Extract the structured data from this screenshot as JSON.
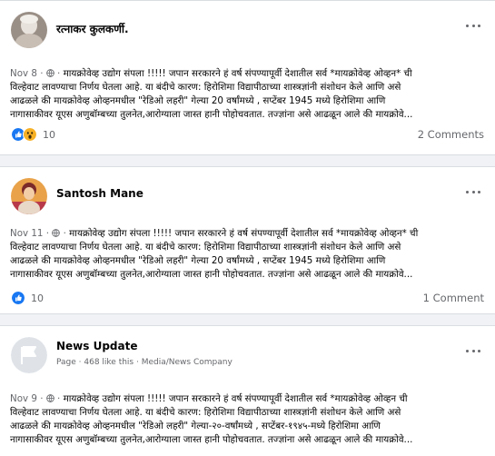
{
  "posts": [
    {
      "author": "रत्नाकर कुलकर्णी.",
      "date": "Nov 8",
      "lines": [
        " मायक्रोवेव्ह उद्योग संपला !!!!! जपान सरकारने हं वर्ष संपण्यापूर्वी देशातील सर्व *मायक्रोवेव्ह ओव्हन* ची",
        "विल्हेवाट लावण्याचा निर्णय घेतला आहे. या बंदीचे कारण: हिरोशिमा विद्यापीठाच्या शास्त्रज्ञांनी संशोधन केले आणि असे",
        "आढळले की मायक्रोवेव्ह ओव्हनमधील \"रेडिओ लहरी\" गेल्या 20 वर्षांमध्ये , सप्टेंबर 1945 मध्ये हिरोशिमा आणि",
        "नागासाकीवर यूएस अणुबॉम्बच्या तुलनेत,आरोग्याला जास्त हानी पोहोचवतात. तज्ज्ञांना असे आढळून आले की मायक्रोवे..."
      ],
      "reaction_count": "10",
      "comments": "2 Comments"
    },
    {
      "author": "Santosh Mane",
      "date": "Nov 11",
      "lines": [
        " मायक्रोवेव्ह उद्योग संपला !!!!! जपान सरकारने हं वर्ष संपण्यापूर्वी देशातील सर्व *मायक्रोवेव्ह ओव्हन* ची",
        "विल्हेवाट लावण्याचा निर्णय घेतला आहे. या बंदीचे कारण: हिरोशिमा विद्यापीठाच्या शास्त्रज्ञांनी संशोधन केले आणि असे",
        "आढळले की मायक्रोवेव्ह ओव्हनमधील \"रेडिओ लहरी\" गेल्या 20 वर्षांमध्ये , सप्टेंबर 1945 मध्ये हिरोशिमा आणि",
        "नागासाकीवर यूएस अणुबॉम्बच्या तुलनेत,आरोग्याला जास्त हानी पोहोचवतात. तज्ज्ञांना असे आढळून आले की मायक्रोवे..."
      ],
      "reaction_count": "10",
      "comments": "1 Comment"
    },
    {
      "author": "News Update",
      "subtitle": "Page · 468 like this · Media/News Company",
      "date": "Nov 9",
      "lines": [
        " मायक्रोवेव्ह उद्योग संपला !!!!! जपान सरकारने हं वर्ष संपण्यापूर्वी देशातील सर्व *मायक्रोवेव्ह ओव्हन ची",
        "विल्हेवाट लावण्याचा निर्णय घेतला आहे. या बंदीचे कारण: हिरोशिमा विद्यापीठाच्या शास्त्रज्ञांनी संशोधन केले आणि असे",
        "आढळले की मायक्रोवेव्ह ओव्हनमधील \"रेडिओ लहरी\" गेल्या-२०-वर्षांमध्ये , सप्टेंबर-१९४५-मध्ये हिरोशिमा आणि",
        "नागासाकीवर यूएस अणुबॉम्बच्या तुलनेत,आरोग्याला जास्त हानी पोहोचवतात. तज्ज्ञांना असे आढळून आले की मायक्रोवे..."
      ]
    }
  ],
  "icons": {
    "more": "more-options-icon",
    "privacy": "globe-icon",
    "like": "like-icon",
    "wow": "wow-icon"
  },
  "colors": {
    "like_blue": "#1877f2",
    "wow_yellow": "#f7b125",
    "muted": "#65676b"
  }
}
